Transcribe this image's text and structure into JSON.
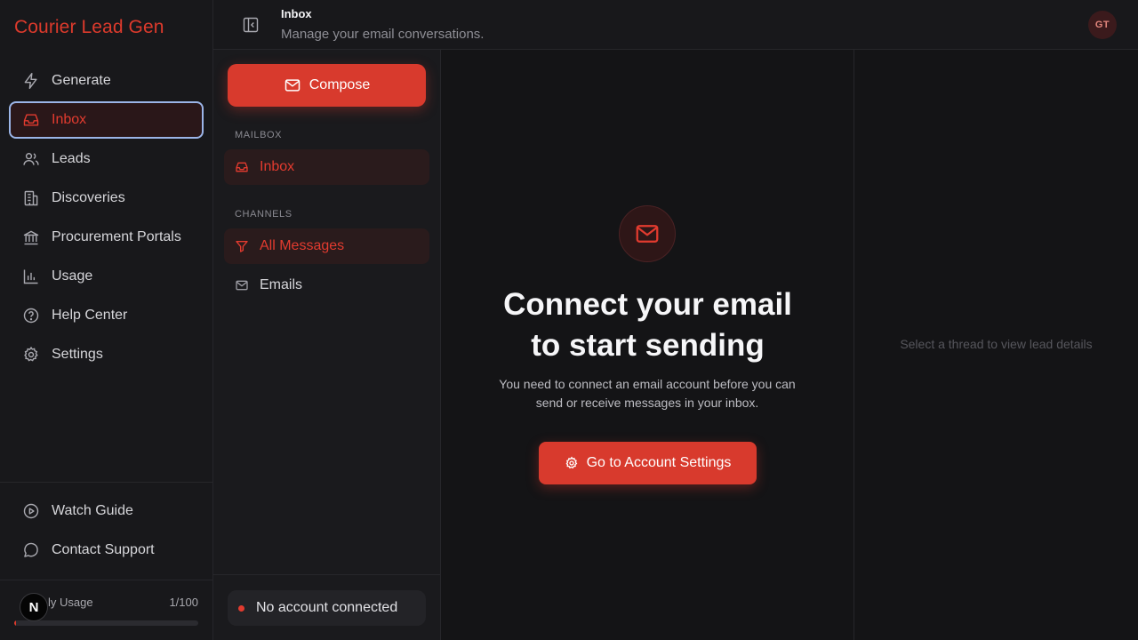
{
  "brand": "Courier Lead Gen",
  "sidebar": {
    "items": [
      {
        "label": "Generate",
        "icon": "bolt-icon"
      },
      {
        "label": "Inbox",
        "icon": "inbox-icon",
        "active": true
      },
      {
        "label": "Leads",
        "icon": "users-icon"
      },
      {
        "label": "Discoveries",
        "icon": "building-icon"
      },
      {
        "label": "Procurement Portals",
        "icon": "landmark-icon"
      },
      {
        "label": "Usage",
        "icon": "bar-chart-icon"
      },
      {
        "label": "Help Center",
        "icon": "help-circle-icon"
      },
      {
        "label": "Settings",
        "icon": "gear-icon"
      }
    ],
    "bottom": [
      {
        "label": "Watch Guide",
        "icon": "play-circle-icon"
      },
      {
        "label": "Contact Support",
        "icon": "message-circle-icon"
      }
    ],
    "usage": {
      "label": "ly Usage",
      "value": "1/100",
      "fraction": 0.01
    },
    "badge": "N"
  },
  "header": {
    "title": "Inbox",
    "subtitle": "Manage your email conversations.",
    "avatar": "GT"
  },
  "mailbox": {
    "compose_label": "Compose",
    "section_mailbox": "MAILBOX",
    "inbox_label": "Inbox",
    "section_channels": "CHANNELS",
    "all_messages_label": "All Messages",
    "emails_label": "Emails",
    "status": "No account connected"
  },
  "main": {
    "headline_line1": "Connect your email",
    "headline_line2": "to start sending",
    "description_line1": "You need to connect an email account before you can",
    "description_line2": "send or receive messages in your inbox.",
    "cta_label": "Go to Account Settings"
  },
  "details": {
    "hint": "Select a thread to view lead details"
  },
  "colors": {
    "accent": "#dc3a2c",
    "background": "#141416",
    "sidebar": "#18181b",
    "active_outline": "#9bb5e8"
  }
}
